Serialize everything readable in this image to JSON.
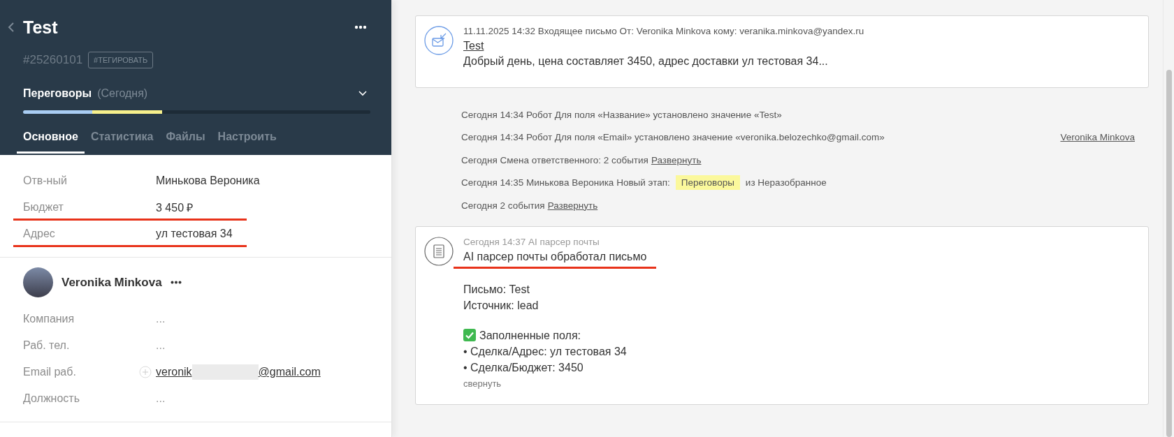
{
  "lead": {
    "title": "Test",
    "number": "#25260101",
    "tag_button": "#ТЕГИРОВАТЬ"
  },
  "stage": {
    "name": "Переговоры",
    "when": "(Сегодня)",
    "segments": [
      {
        "color": "#a9cdf3",
        "level": 0.2
      },
      {
        "color": "#f7f08c",
        "level": 0.2
      }
    ]
  },
  "tabs": [
    {
      "label": "Основное",
      "selected": true
    },
    {
      "label": "Статистика",
      "selected": false
    },
    {
      "label": "Файлы",
      "selected": false
    },
    {
      "label": "Настроить",
      "selected": false
    }
  ],
  "fields": [
    {
      "label": "Отв-ный",
      "value": "Минькова Вероника",
      "underlined": false
    },
    {
      "label": "Бюджет",
      "value": "3 450 ₽",
      "underlined": true
    },
    {
      "label": "Адрес",
      "value": "ул тестовая 34",
      "underlined": true
    }
  ],
  "contact": {
    "name": "Veronika Minkova",
    "fields": [
      {
        "kind": "text",
        "label": "Компания",
        "placeholder": "..."
      },
      {
        "kind": "text",
        "label": "Раб. тел.",
        "placeholder": "..."
      },
      {
        "kind": "email",
        "label": "Email раб.",
        "value": "veronik",
        "value_end": "@gmail.com"
      },
      {
        "kind": "text",
        "label": "Должность",
        "placeholder": "..."
      }
    ]
  },
  "email_card": {
    "meta": "11.11.2025 14:32 Входящее письмо От: Veronika Minkova кому: veranika.minkova@yandex.ru",
    "subject": "Test",
    "preview": "Добрый день, цена составляет 3450, адрес доставки ул тестовая 34..."
  },
  "events": [
    {
      "kind": "text",
      "text": "Сегодня 14:34 Робот Для поля «Название» установлено значение «Test»"
    },
    {
      "kind": "text",
      "text": "Сегодня 14:34 Робот Для поля «Email» установлено значение «veronika.belozechko@gmail.com»",
      "author": "Veronika Minkova"
    },
    {
      "kind": "expand",
      "text": "Сегодня Смена ответственного: 2 события",
      "link": "Развернуть"
    },
    {
      "kind": "stage",
      "text": "Сегодня 14:35 Минькова Вероника Новый этап:",
      "stage": "Переговоры",
      "after": "из Неразобранное"
    },
    {
      "kind": "expand",
      "text": "Сегодня 2 события",
      "link": "Развернуть"
    }
  ],
  "parser_card": {
    "meta": "Сегодня 14:37 AI парсер почты",
    "title": "AI парсер почты обработал письмо",
    "title_underlined": true,
    "paragraphs": [
      {
        "checked": false,
        "lines": [
          "Письмо: Test",
          "Источник: lead"
        ]
      },
      {
        "checked": true,
        "lines": [
          "Заполненные поля:",
          "• Сделка/Адрес: ул тестовая 34",
          "• Сделка/Бюджет: 3450"
        ]
      }
    ],
    "collapse": "свернуть"
  }
}
